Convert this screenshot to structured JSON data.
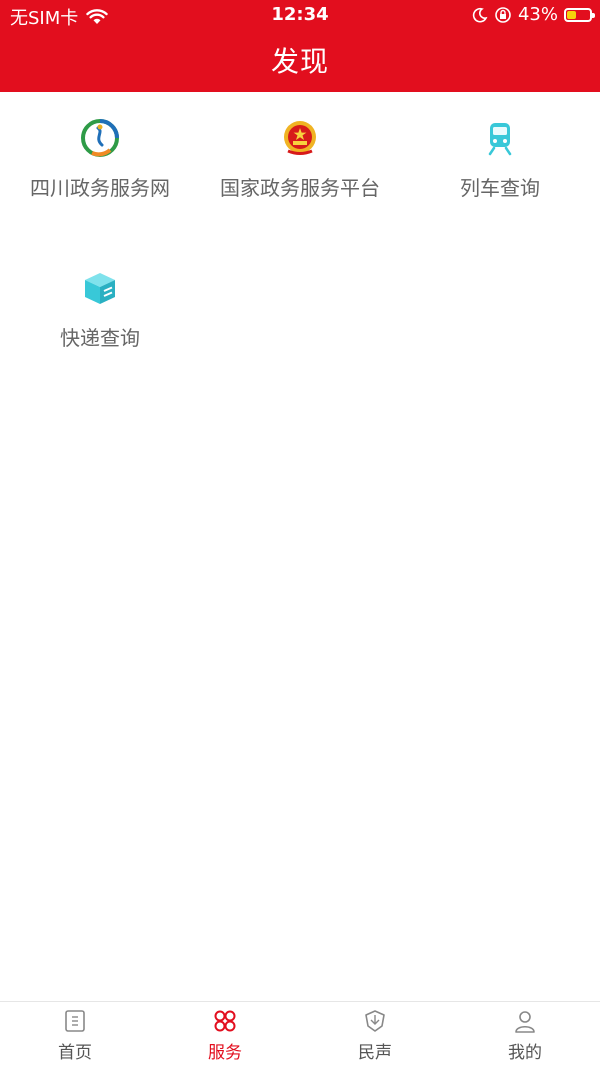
{
  "status_bar": {
    "carrier": "无SIM卡",
    "time": "12:34",
    "battery": "43%",
    "battery_level": 0.43
  },
  "header": {
    "title": "发现"
  },
  "services": [
    {
      "label": "四川政务服务网",
      "icon": "sichuan-gov-logo-icon"
    },
    {
      "label": "国家政务服务平台",
      "icon": "national-emblem-icon"
    },
    {
      "label": "列车查询",
      "icon": "train-icon"
    },
    {
      "label": "快递查询",
      "icon": "parcel-box-icon"
    }
  ],
  "tabbar": {
    "items": [
      {
        "label": "首页",
        "icon": "home-doc-icon"
      },
      {
        "label": "服务",
        "icon": "services-grid-icon",
        "active": true
      },
      {
        "label": "民声",
        "icon": "voice-shield-icon"
      },
      {
        "label": "我的",
        "icon": "user-icon"
      }
    ]
  },
  "colors": {
    "brand_red": "#e20e1e",
    "text_gray": "#666666",
    "icon_cyan": "#38c8d8",
    "battery_yellow": "#f5d20b"
  }
}
